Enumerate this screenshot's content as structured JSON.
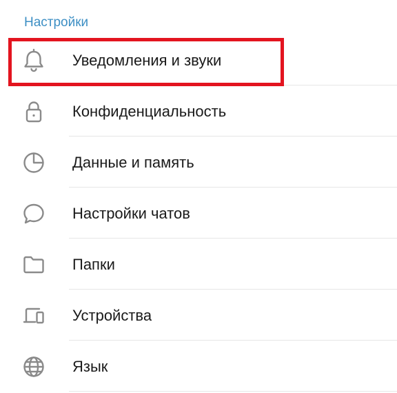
{
  "section": {
    "title": "Настройки"
  },
  "items": [
    {
      "label": "Уведомления и звуки",
      "icon": "bell-icon"
    },
    {
      "label": "Конфиденциальность",
      "icon": "lock-icon"
    },
    {
      "label": "Данные и память",
      "icon": "pie-chart-icon"
    },
    {
      "label": "Настройки чатов",
      "icon": "chat-bubble-icon"
    },
    {
      "label": "Папки",
      "icon": "folder-icon"
    },
    {
      "label": "Устройства",
      "icon": "devices-icon"
    },
    {
      "label": "Язык",
      "icon": "globe-icon"
    }
  ],
  "colors": {
    "section_header": "#3d8fc4",
    "icon": "#8a8a8a",
    "text": "#1a1a1a",
    "highlight": "#e3141f"
  }
}
